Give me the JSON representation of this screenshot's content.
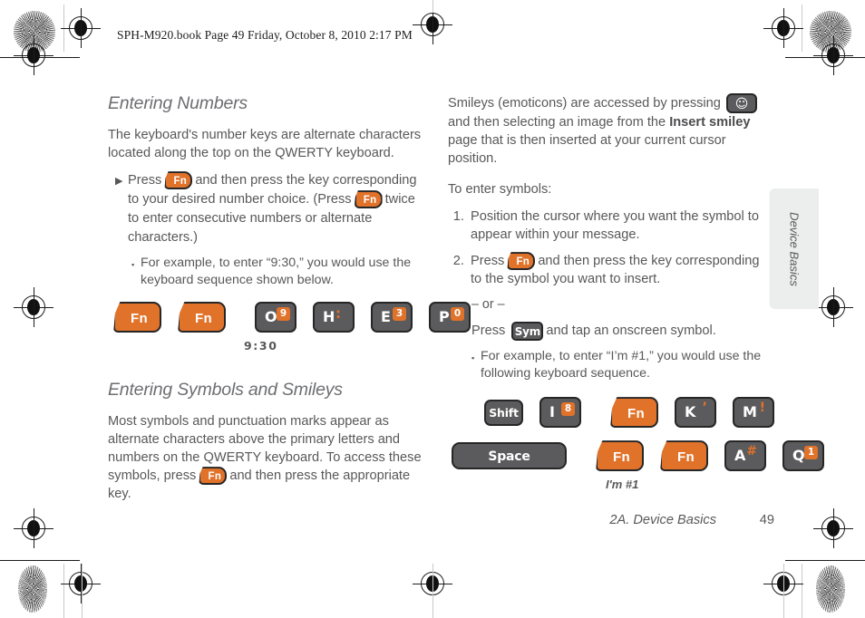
{
  "running_head": "SPH-M920.book  Page 49  Friday, October 8, 2010  2:17 PM",
  "colors": {
    "orange": "#e0722a",
    "key_dark": "#5b5b5d",
    "text": "#58585a",
    "tab_bg": "#eceded"
  },
  "left_column": {
    "heading": "Entering Numbers",
    "intro": "The keyboard's number keys are alternate characters located along the top on the QWERTY keyboard.",
    "arrow_marker": "▶",
    "square_marker": "▪",
    "bullet": {
      "part1": "Press",
      "key1": "Fn",
      "part2": "and then press the key corresponding to your desired number choice. (Press",
      "key2": "Fn",
      "part3": "twice to enter consecutive numbers or alternate characters.)"
    },
    "example": "For example, to enter “9:30,” you would use the keyboard sequence shown below.",
    "sequence": {
      "keys": [
        {
          "type": "fn",
          "label": "Fn"
        },
        {
          "type": "fn",
          "label": "Fn"
        },
        {
          "type": "letter",
          "main": "O",
          "badge": "9"
        },
        {
          "type": "letter",
          "main": "H",
          "alt": ":"
        },
        {
          "type": "letter",
          "main": "E",
          "badge": "3"
        },
        {
          "type": "letter",
          "main": "P",
          "badge": "0"
        }
      ],
      "caption": "9:30"
    },
    "heading2": "Entering Symbols and Smileys",
    "symbols_body": {
      "part1": "Most symbols and punctuation marks appear as alternate characters above the primary letters and numbers on the QWERTY keyboard. To access these symbols, press",
      "key": "Fn",
      "part2": "and then press the appropriate key."
    }
  },
  "right_column": {
    "smileys": {
      "part1": "Smileys (emoticons) are accessed by pressing",
      "key_icon": "smiley-key",
      "key_glyph": "☺",
      "part2": "and then selecting an image from the",
      "bold": "Insert smiley",
      "part3": "page that is then inserted at your current cursor position."
    },
    "to_enter": "To enter symbols:",
    "steps": [
      {
        "number": "1.",
        "text": "Position the cursor where you want the symbol to appear within your message."
      },
      {
        "number": "2.",
        "part1": "Press",
        "key": "Fn",
        "part2": "and then press the key corresponding to the symbol you want to insert."
      }
    ],
    "or_line": "– or –",
    "sym_line": {
      "part1": "Press",
      "key": "Sym",
      "part2": "and tap an onscreen symbol."
    },
    "square_marker": "▪",
    "example": "For example, to enter “I’m #1,” you would use the following keyboard sequence.",
    "sequence_row1": [
      {
        "type": "dark",
        "label": "Shift"
      },
      {
        "type": "letter",
        "main": "I",
        "badge": "8"
      },
      {
        "type": "fn",
        "label": "Fn"
      },
      {
        "type": "letter",
        "main": "K",
        "alt": "’"
      },
      {
        "type": "letter",
        "main": "M",
        "alt": "!"
      }
    ],
    "sequence_row2": [
      {
        "type": "space",
        "label": "Space"
      },
      {
        "type": "fn",
        "label": "Fn"
      },
      {
        "type": "fn",
        "label": "Fn"
      },
      {
        "type": "letter",
        "main": "A",
        "alt": "#"
      },
      {
        "type": "letter",
        "main": "Q",
        "badge": "1"
      }
    ],
    "sequence_caption": "I'm #1"
  },
  "thumb_tab": {
    "label": "Device Basics"
  },
  "footer": {
    "chapter": "2A. Device Basics",
    "page_number": "49"
  }
}
